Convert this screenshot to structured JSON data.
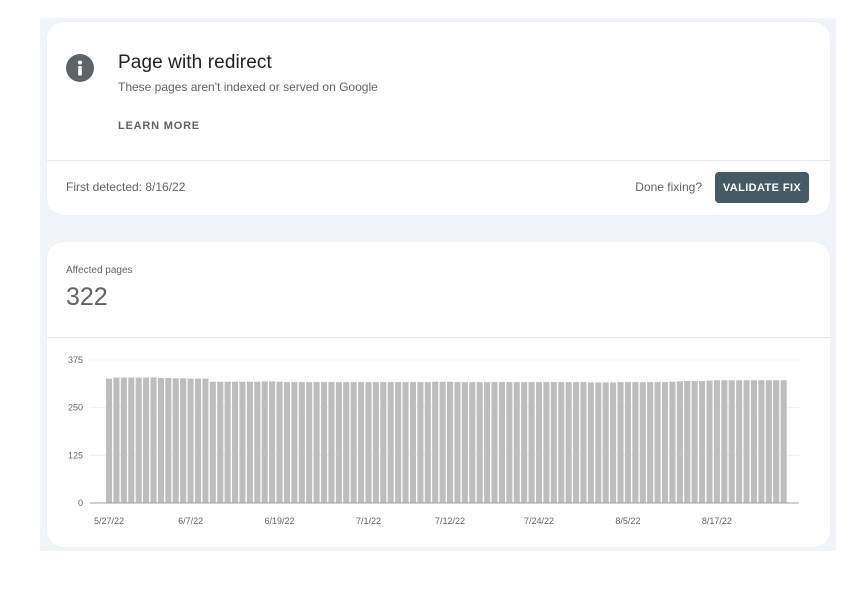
{
  "issue": {
    "title": "Page with redirect",
    "subtitle": "These pages aren't indexed or served on Google",
    "learn_more": "LEARN MORE",
    "first_detected": "First detected: 8/16/22",
    "done_fixing": "Done fixing?",
    "validate_fix": "VALIDATE FIX",
    "icon": "info-icon"
  },
  "affected": {
    "label": "Affected pages",
    "count": "322"
  },
  "colors": {
    "bar": "#bdbdbd",
    "button": "#455a64",
    "icon": "#5f6368"
  },
  "chart_data": {
    "type": "bar",
    "title": "",
    "xlabel": "",
    "ylabel": "",
    "ylim": [
      0,
      375
    ],
    "y_ticks": [
      0,
      125,
      250,
      375
    ],
    "x_tick_labels": [
      "5/27/22",
      "6/7/22",
      "6/19/22",
      "7/1/22",
      "7/12/22",
      "7/24/22",
      "8/5/22",
      "8/17/22"
    ],
    "x_tick_indices": [
      0,
      11,
      23,
      35,
      46,
      58,
      70,
      82
    ],
    "grid": true,
    "series": [
      {
        "values": [
          326,
          329,
          329,
          329,
          329,
          329,
          329,
          328,
          328,
          327,
          327,
          326,
          326,
          326,
          318,
          318,
          318,
          318,
          318,
          318,
          318,
          319,
          319,
          318,
          317,
          317,
          317,
          317,
          317,
          317,
          317,
          317,
          317,
          317,
          317,
          317,
          317,
          317,
          317,
          317,
          317,
          317,
          317,
          317,
          318,
          318,
          318,
          317,
          317,
          317,
          317,
          317,
          317,
          317,
          317,
          317,
          317,
          317,
          317,
          317,
          317,
          317,
          317,
          317,
          317,
          316,
          316,
          316,
          316,
          317,
          317,
          317,
          317,
          317,
          317,
          317,
          318,
          319,
          320,
          320,
          320,
          321,
          322,
          322,
          322,
          322,
          322,
          322,
          322,
          322,
          322,
          322
        ]
      }
    ]
  }
}
